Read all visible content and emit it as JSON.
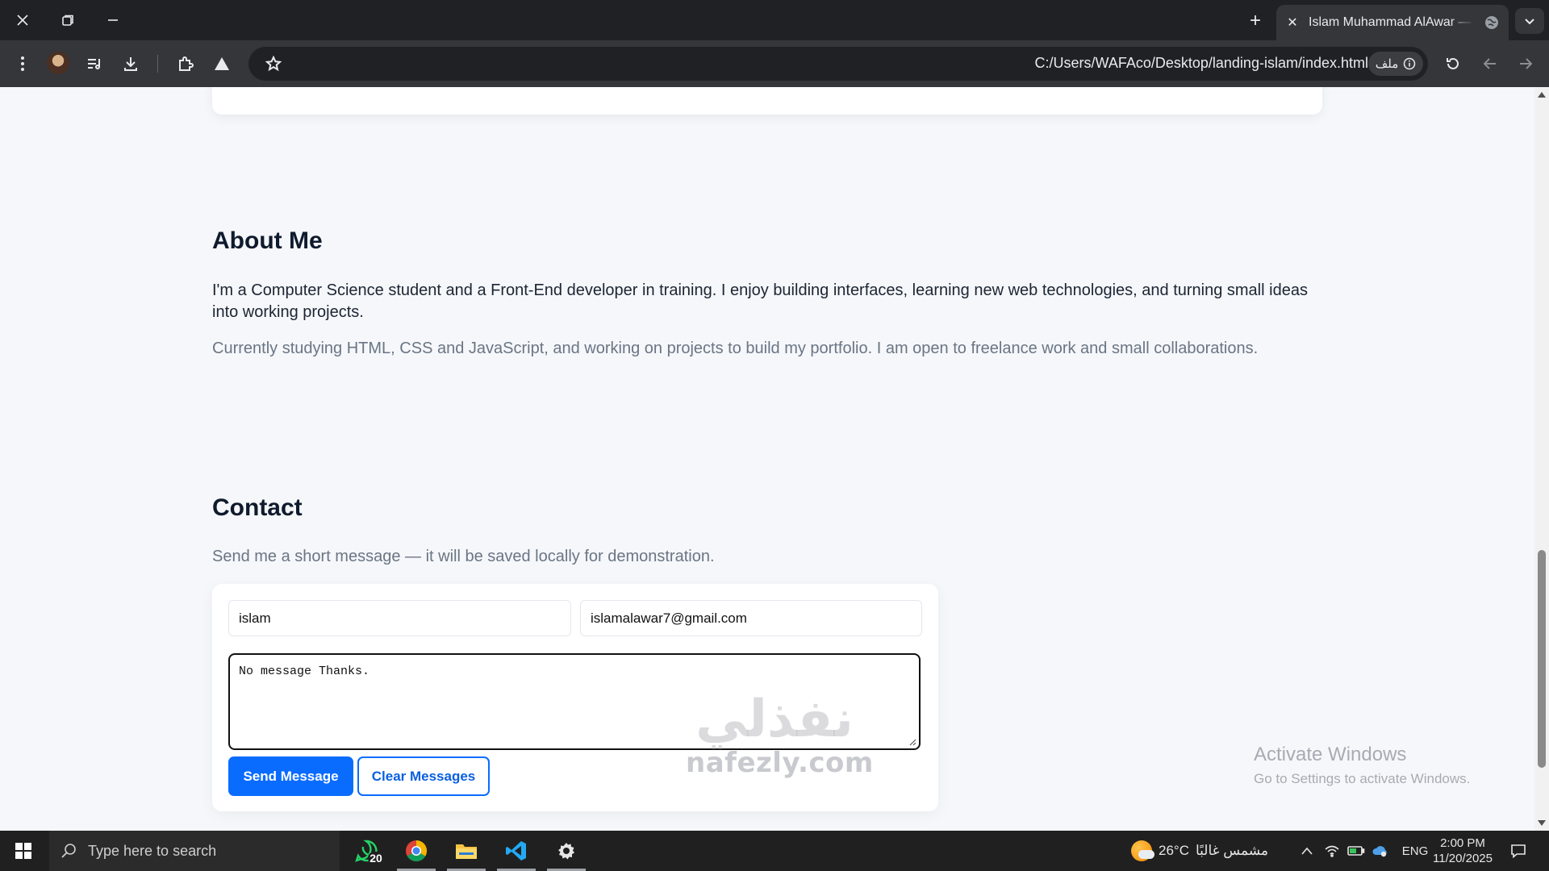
{
  "browser": {
    "tab_title": "Islam Muhammad AlAwar — Fr",
    "new_tab_label": "+",
    "tab_close_label": "✕",
    "url": "C:/Users/WAFAco/Desktop/landing-islam/index.html",
    "site_chip_label": "ملف",
    "theme": {
      "frame": "#202124",
      "toolbar": "#35363a"
    }
  },
  "page": {
    "about": {
      "heading": "About Me",
      "paragraph": "I'm a Computer Science student and a Front-End developer in training. I enjoy building interfaces, learning new web technologies, and turning small ideas into working projects.",
      "muted": "Currently studying HTML, CSS and JavaScript, and working on projects to build my portfolio. I am open to freelance work and small collaborations."
    },
    "contact": {
      "heading": "Contact",
      "subtitle": "Send me a short message — it will be saved locally for demonstration.",
      "form": {
        "name_value": "islam",
        "email_value": "islamalawar7@gmail.com",
        "message_value": "No message Thanks.",
        "send_label": "Send Message",
        "clear_label": "Clear Messages"
      }
    },
    "accent_color": "#0a6cff"
  },
  "overlay": {
    "activate_title": "Activate Windows",
    "activate_sub": "Go to Settings to activate Windows.",
    "watermark_ar": "نفذلي",
    "watermark_en": "nafezly.com"
  },
  "taskbar": {
    "search_placeholder": "Type here to search",
    "whatsapp_badge": "20",
    "weather_temp": "26°C",
    "weather_desc": "مشمس غالبًا",
    "language": "ENG",
    "time": "2:00 PM",
    "date": "11/20/2025",
    "pinned": [
      "whatsapp-icon",
      "chrome-icon",
      "file-explorer-icon",
      "vscode-icon",
      "settings-icon"
    ]
  }
}
